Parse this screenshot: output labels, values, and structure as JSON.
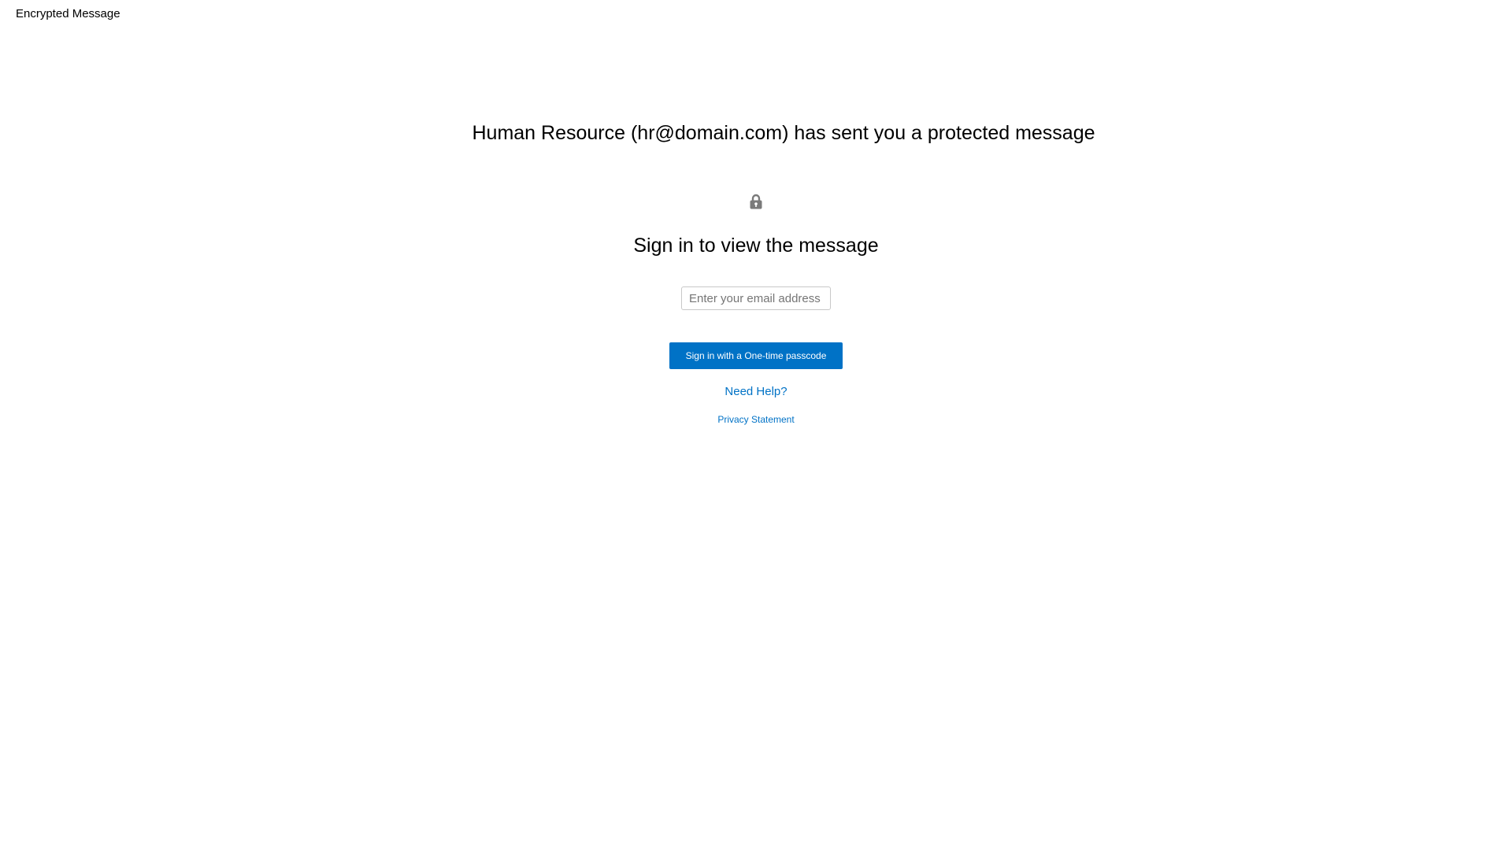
{
  "header": {
    "title": "Encrypted Message"
  },
  "main": {
    "headline": "Human Resource (hr@domain.com) has sent you a protected message",
    "icon": "lock-icon",
    "subheadline": "Sign in to view the message",
    "email": {
      "value": "",
      "placeholder": "Enter your email address"
    },
    "signin_button_label": "Sign in with a One-time passcode",
    "help_link": "Need Help?",
    "privacy_link": "Privacy Statement"
  },
  "colors": {
    "accent": "#0072c6",
    "lock": "#7a7a7a",
    "input_border": "#c8c8c8"
  }
}
